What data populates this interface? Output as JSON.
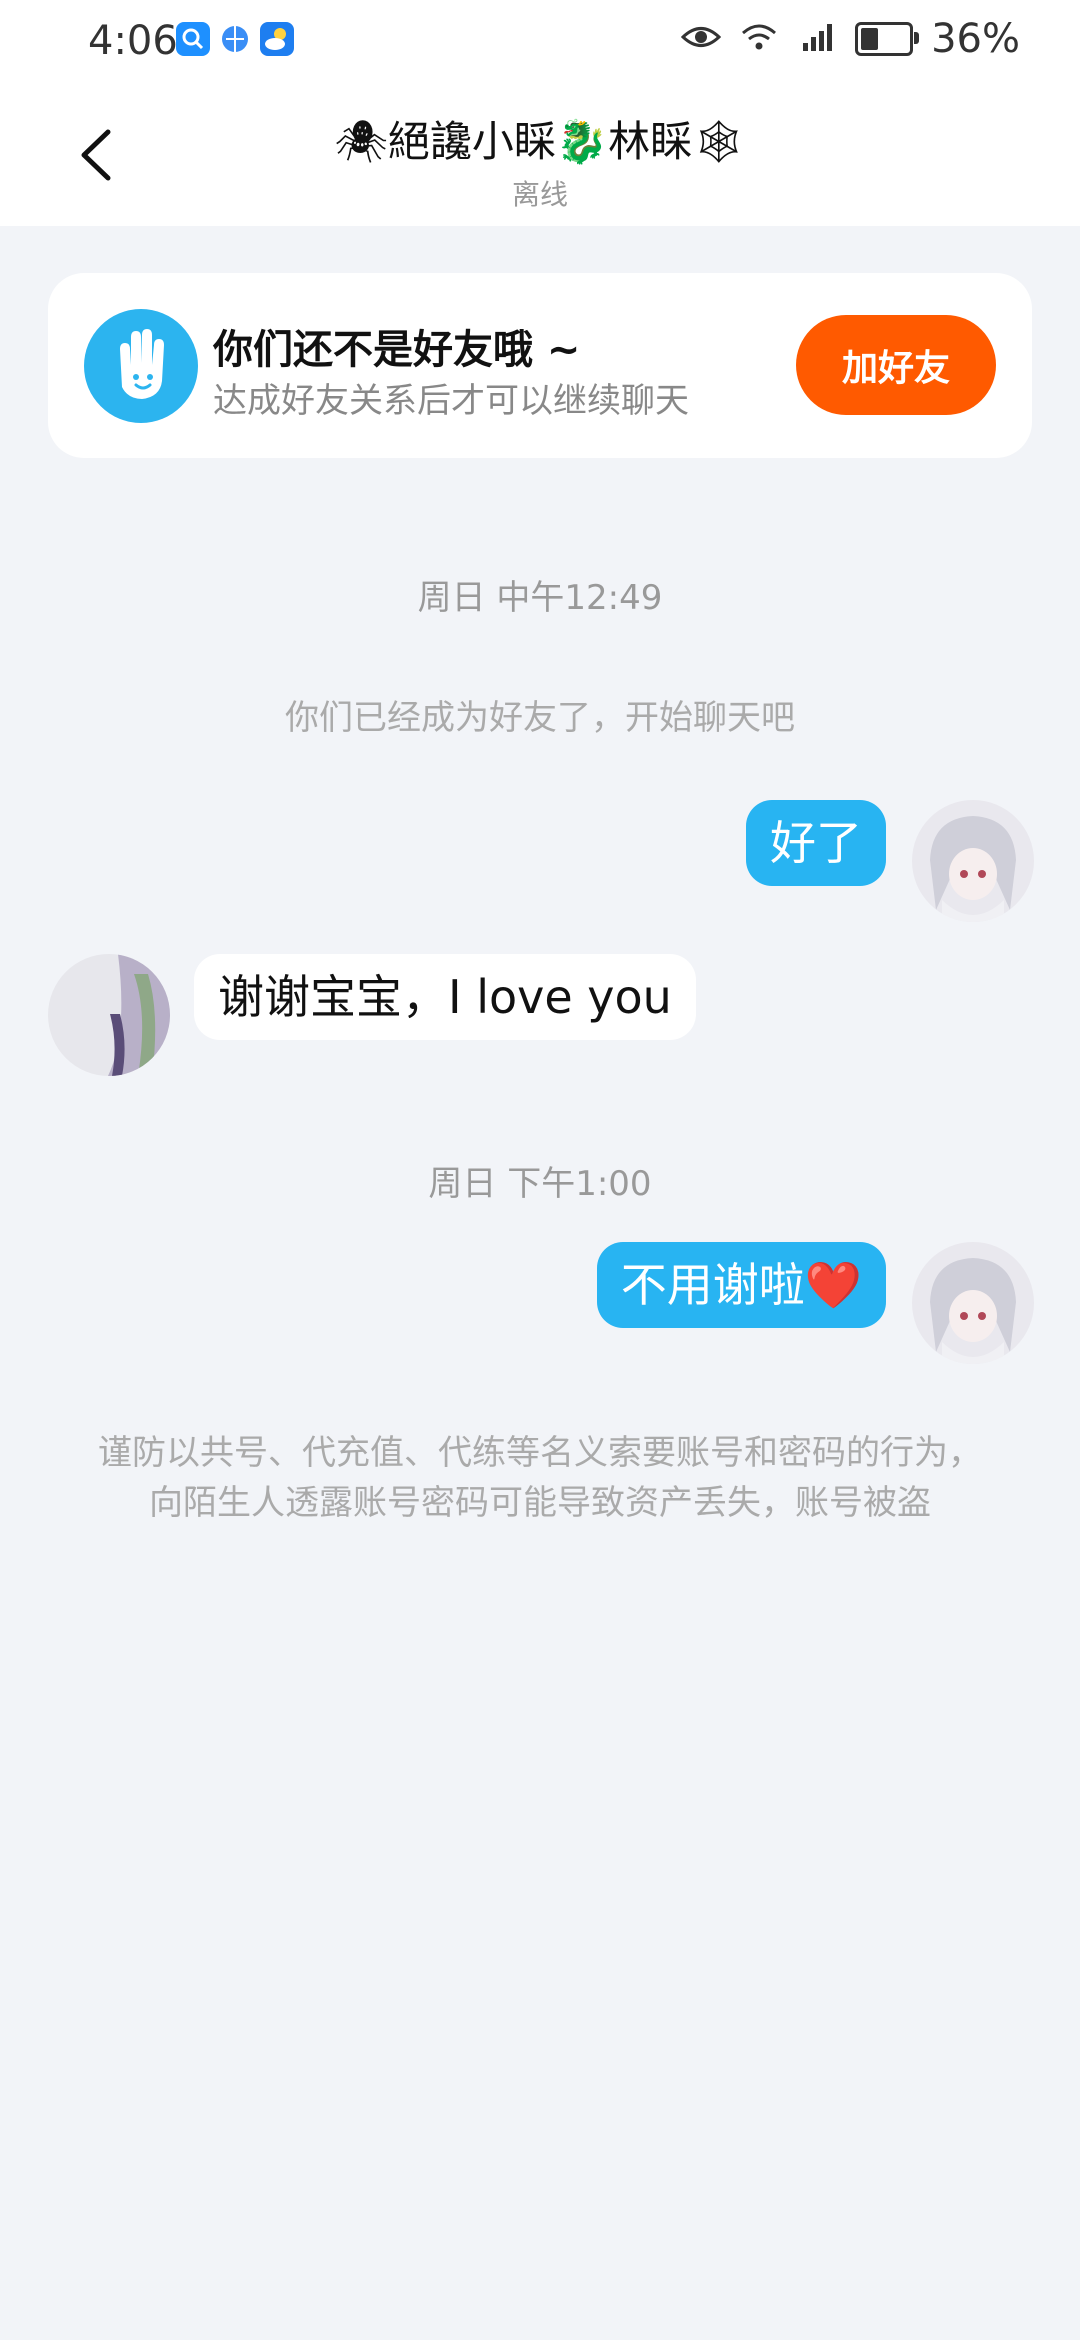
{
  "status_bar": {
    "time": "4:06",
    "battery_percent": "36%",
    "battery_level": 0.36
  },
  "header": {
    "title": "🕷絕讒小睬🐉林睬🕸",
    "status": "离线"
  },
  "friend_card": {
    "title": "你们还不是好友哦 ~",
    "subtitle": "达成好友关系后才可以继续聊天",
    "add_button_label": "加好友"
  },
  "chat": {
    "timestamp_1": "周日 中午12:49",
    "system_notice": "你们已经成为好友了，开始聊天吧",
    "message_1": "好了",
    "message_2": "谢谢宝宝，I love you",
    "timestamp_2": "周日 下午1:00",
    "message_3": "不用谢啦❤️",
    "warning": "谨防以共号、代充值、代练等名义索要账号和密码的行为，向陌生人透露账号密码可能导致资产丢失，账号被盗"
  },
  "colors": {
    "accent_blue": "#28b4f2",
    "add_orange": "#ff5a00",
    "background": "#f2f4f8"
  }
}
